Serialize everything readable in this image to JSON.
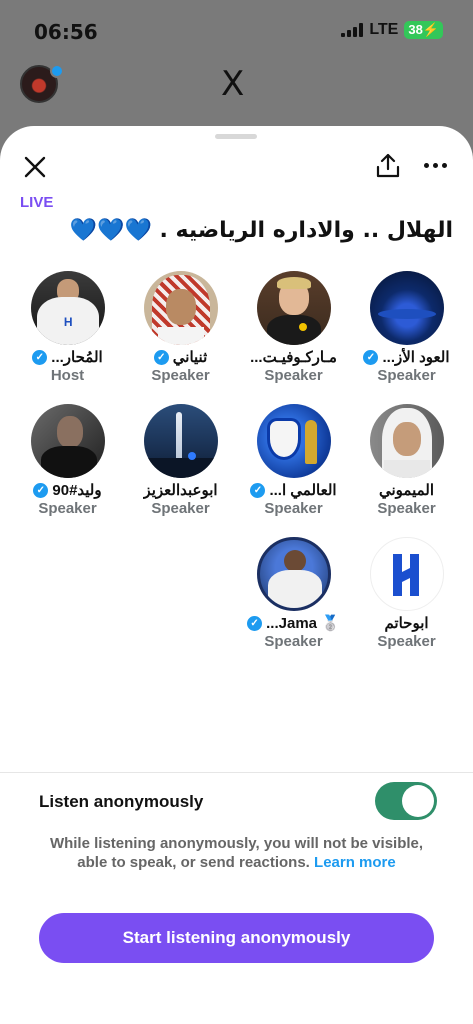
{
  "status_bar": {
    "time": "06:56",
    "network": "LTE",
    "battery": "38"
  },
  "top_bar": {
    "logo": "X"
  },
  "space": {
    "live_label": "LIVE",
    "title": "الهلال .. والاداره الرياضيه . 💙💙💙",
    "participants": [
      {
        "name": "العود الأز...",
        "role": "Speaker",
        "verified": true,
        "avatar": "stadium-avatar"
      },
      {
        "name": "مـاركـوفيـت...",
        "role": "Speaker",
        "verified": false,
        "avatar": "player-avatar"
      },
      {
        "name": "ثنياني",
        "role": "Speaker",
        "verified": true,
        "avatar": "man-red-ghutra-avatar"
      },
      {
        "name": "ًالمُحار...",
        "role": "Host",
        "verified": true,
        "avatar": "player-hilal-kit-avatar"
      },
      {
        "name": "الميموني",
        "role": "Speaker",
        "verified": false,
        "avatar": "man-white-ghutra-avatar"
      },
      {
        "name": "العالمي ا...",
        "role": "Speaker",
        "verified": true,
        "avatar": "hilal-logo-trophy-avatar"
      },
      {
        "name": "ابوعبدالعزيز",
        "role": "Speaker",
        "verified": false,
        "avatar": "fountain-avatar"
      },
      {
        "name": "وليد#90",
        "role": "Speaker",
        "verified": true,
        "avatar": "man-dark-avatar"
      },
      {
        "name": "ابوحاتم",
        "role": "Speaker",
        "verified": false,
        "avatar": "hilal-logo-avatar"
      },
      {
        "name": "🥈 Jama...",
        "role": "Speaker",
        "verified": true,
        "avatar": "player-celebration-avatar"
      }
    ]
  },
  "anonymous": {
    "label": "Listen anonymously",
    "toggle_on": true,
    "info_text": "While listening anonymously, you will not be visible, able to speak, or send reactions.",
    "learn_more": "Learn more",
    "cta": "Start listening anonymously"
  },
  "colors": {
    "accent": "#7a4ef2",
    "link": "#1d9bf0",
    "toggle": "#2f8f6a"
  }
}
